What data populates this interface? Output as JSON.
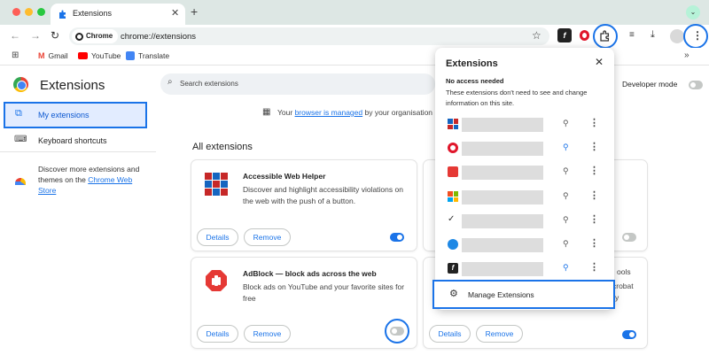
{
  "browser": {
    "tab_title": "Extensions",
    "tab_close": "✕",
    "new_tab": "+",
    "chip_label": "Chrome",
    "url": "chrome://extensions",
    "chevron": "⌄"
  },
  "bookmarks": [
    {
      "label": "Gmail"
    },
    {
      "label": "YouTube"
    },
    {
      "label": "Translate"
    }
  ],
  "page": {
    "title": "Extensions",
    "search_placeholder": "Search extensions",
    "developer_mode_label": "Developer mode",
    "developer_mode_on": false,
    "managed_prefix": "Your",
    "managed_link": "browser is managed",
    "managed_suffix": "by your organisation",
    "all_extensions_heading": "All extensions"
  },
  "sidebar": {
    "my_extensions": "My extensions",
    "keyboard_shortcuts": "Keyboard shortcuts",
    "discover_text": "Discover more extensions and themes on the",
    "discover_link": "Chrome Web Store"
  },
  "cards": [
    {
      "name": "Accessible Web Helper",
      "description": "Discover and highlight accessibility violations on the web with the push of a button.",
      "details": "Details",
      "remove": "Remove",
      "enabled": true
    },
    {
      "name": "AdBlock — block ads across the web",
      "description": "Block ads on YouTube and your favorite sites for free",
      "details": "Details",
      "remove": "Remove",
      "enabled": false
    },
    {
      "details": "Details",
      "remove": "Remove",
      "enabled": false
    },
    {
      "details": "Details",
      "remove": "Remove",
      "enabled": true
    }
  ],
  "card_fragments": {
    "tools": "ools",
    "acrobat": "crobat",
    "y": "y"
  },
  "popup": {
    "title": "Extensions",
    "close": "✕",
    "subheading": "No access needed",
    "description": "These extensions don't need to see and change information on this site.",
    "manage_label": "Manage Extensions",
    "rows": [
      {
        "icon": "grid-icon",
        "pinned": false
      },
      {
        "icon": "opera-icon",
        "pinned": true
      },
      {
        "icon": "pdf-icon",
        "pinned": false
      },
      {
        "icon": "windows-icon",
        "pinned": false
      },
      {
        "icon": "check-icon",
        "pinned": false
      },
      {
        "icon": "globe-icon",
        "pinned": false
      },
      {
        "icon": "f-icon",
        "pinned": true
      }
    ]
  },
  "colors": {
    "accent": "#1a73e8",
    "toggle_on": "#1a73e8",
    "toggle_off": "#c4c7c5"
  }
}
